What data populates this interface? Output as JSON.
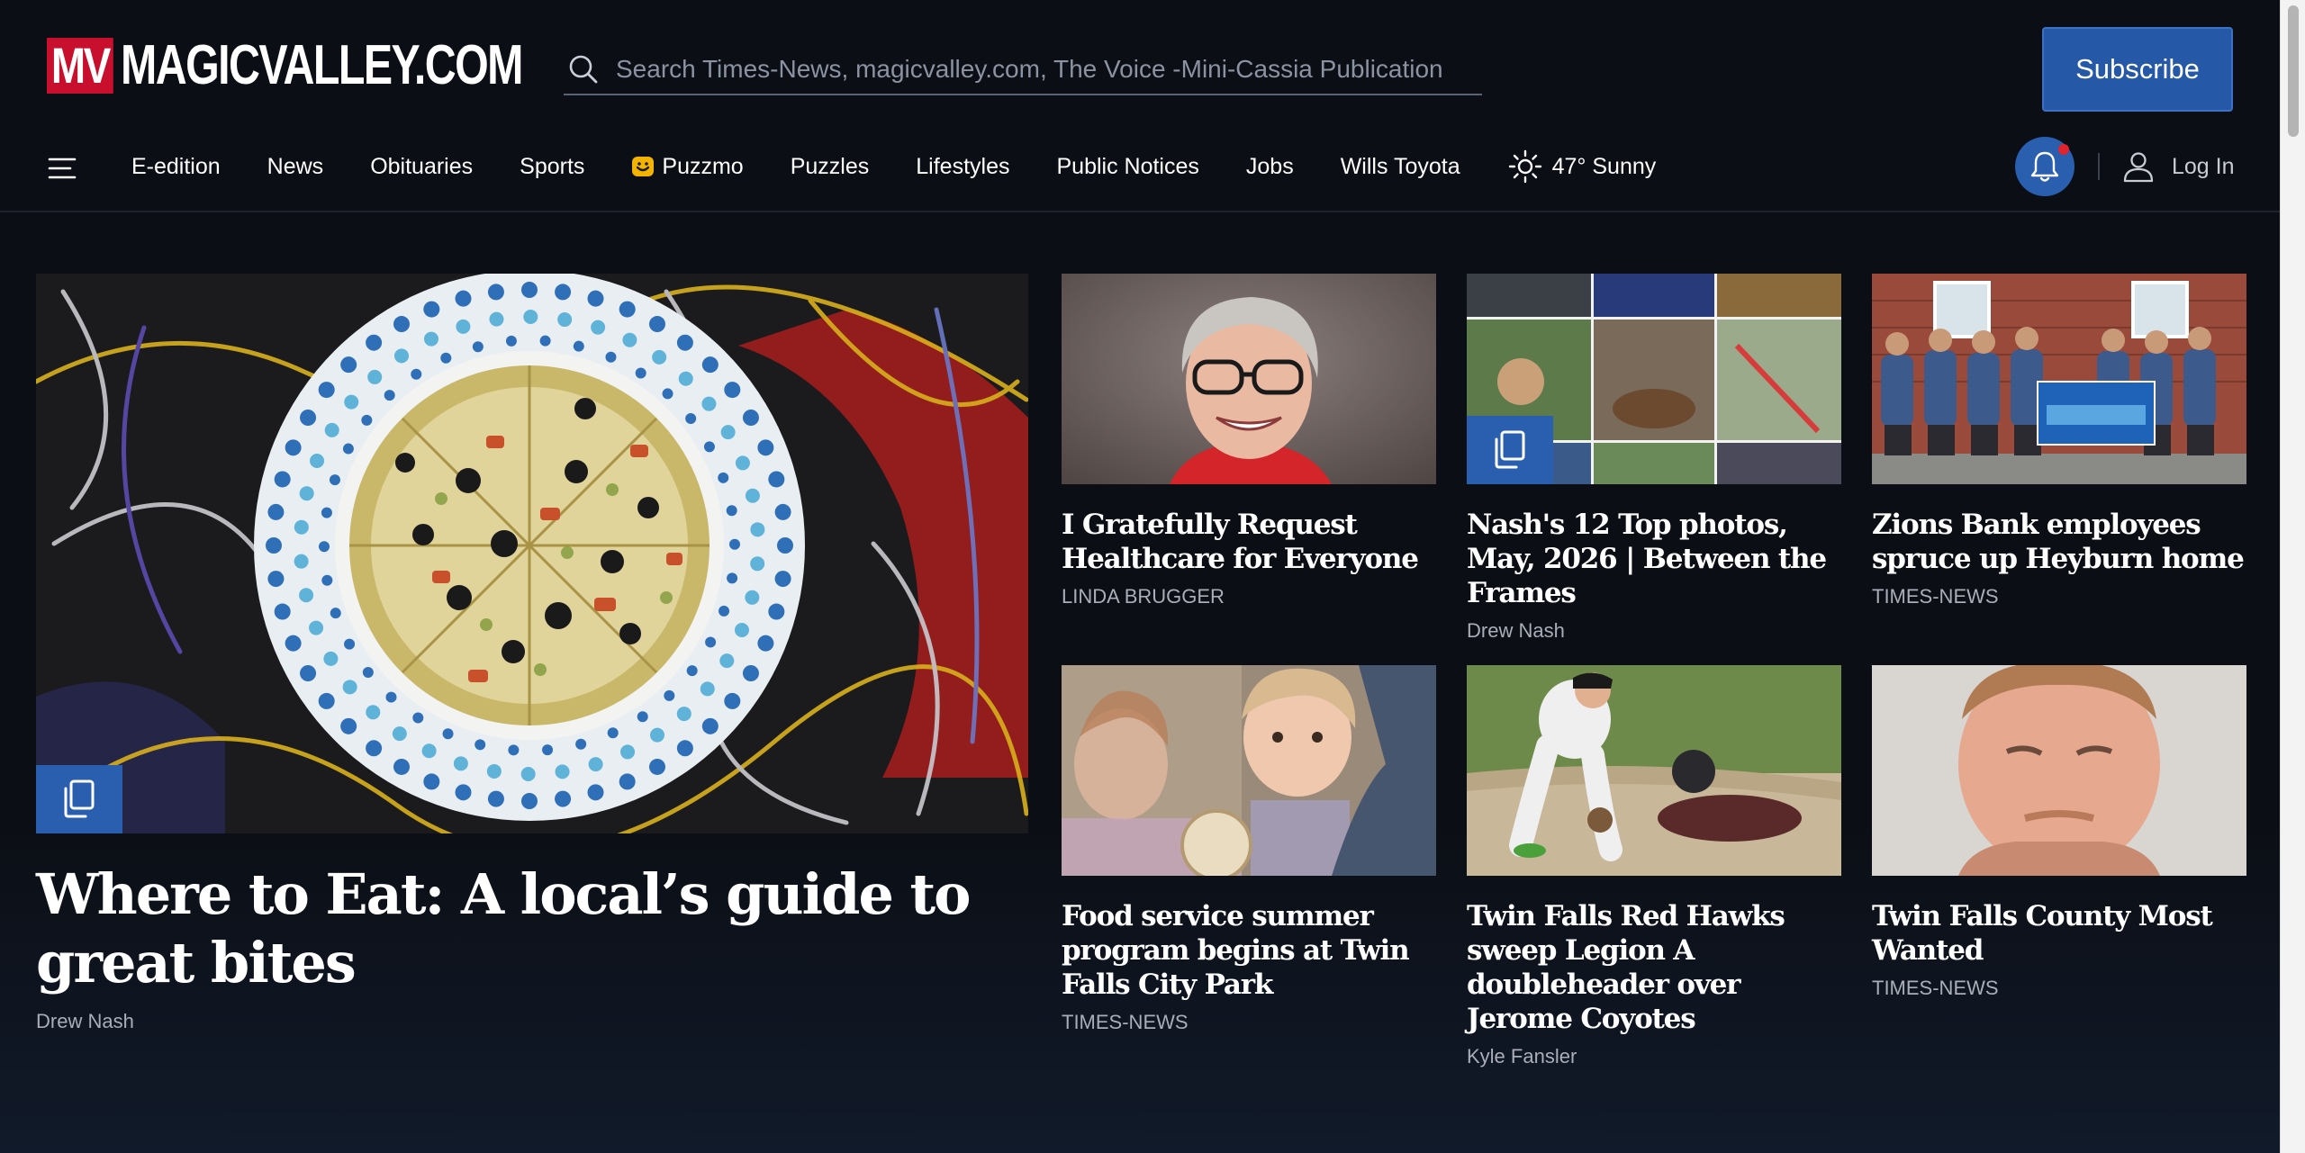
{
  "site": {
    "logo_mark": "MV",
    "logo_text": "MAGICVALLEY.COM"
  },
  "search": {
    "placeholder": "Search Times-News, magicvalley.com, The Voice -Mini-Cassia Publication"
  },
  "header": {
    "subscribe_label": "Subscribe",
    "login_label": "Log In"
  },
  "nav": {
    "items": [
      {
        "label": "E-edition"
      },
      {
        "label": "News"
      },
      {
        "label": "Obituaries"
      },
      {
        "label": "Sports"
      },
      {
        "label": "Puzzmo",
        "icon": "puzzmo-icon"
      },
      {
        "label": "Puzzles"
      },
      {
        "label": "Lifestyles"
      },
      {
        "label": "Public Notices"
      },
      {
        "label": "Jobs"
      },
      {
        "label": "Wills Toyota"
      }
    ],
    "weather": "47° Sunny"
  },
  "lead": {
    "title": "Where to Eat: A local’s guide to great bites",
    "byline": "Drew Nash",
    "image": "pizza-photo",
    "gallery": true
  },
  "cards": [
    {
      "title": "I Gratefully Request Healthcare for Everyone",
      "byline": "LINDA BRUGGER",
      "image": "portrait-woman-photo"
    },
    {
      "title": "Nash's 12 Top photos, May, 2026 | Between the Frames",
      "byline": "Drew Nash",
      "image": "photo-collage",
      "gallery": true
    },
    {
      "title": "Zions Bank employees spruce up Heyburn home",
      "byline": "TIMES-NEWS",
      "image": "group-photo"
    },
    {
      "title": "Food service summer program begins at Twin Falls City Park",
      "byline": "TIMES-NEWS",
      "image": "children-photo"
    },
    {
      "title": "Twin Falls Red Hawks sweep Legion A doubleheader over Jerome Coyotes",
      "byline": "Kyle Fansler",
      "image": "baseball-photo"
    },
    {
      "title": "Twin Falls County Most Wanted",
      "byline": "TIMES-NEWS",
      "image": "mugshot-photo"
    }
  ],
  "colors": {
    "background": "#0b0e14",
    "accent": "#2a5fb0",
    "logo_red": "#c8102e",
    "notification": "#e0242e"
  }
}
